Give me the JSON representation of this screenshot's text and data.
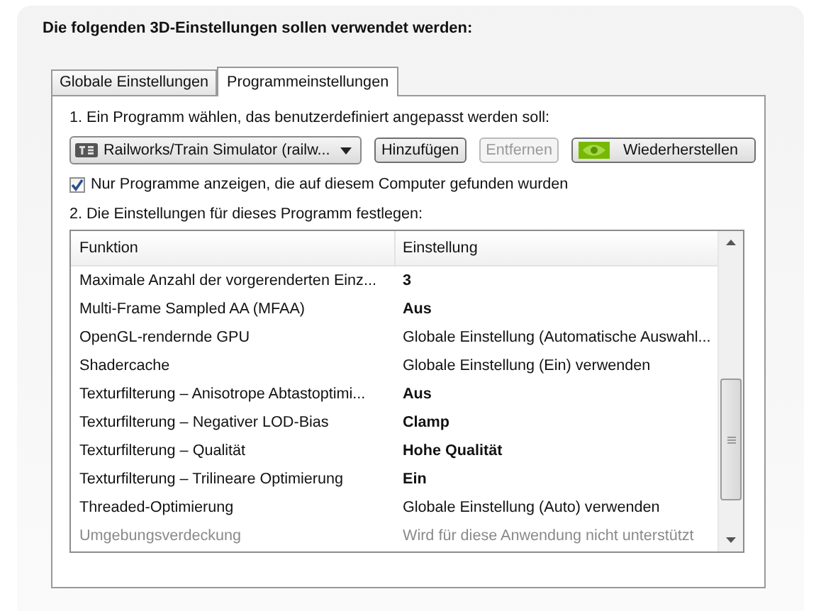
{
  "heading": "Die folgenden 3D-Einstellungen sollen verwendet werden:",
  "tabs": [
    {
      "label": "Globale Einstellungen",
      "selected": false
    },
    {
      "label": "Programmeinstellungen",
      "selected": true
    }
  ],
  "step1_label": "1. Ein Programm wählen, das benutzerdefiniert angepasst werden soll:",
  "program_select": {
    "value": "Railworks/Train Simulator (railw..."
  },
  "buttons": [
    {
      "label": "Hinzufügen",
      "disabled": false,
      "kind": "plain"
    },
    {
      "label": "Entfernen",
      "disabled": true,
      "kind": "plain"
    },
    {
      "label": "Wiederherstellen",
      "disabled": false,
      "kind": "logo"
    }
  ],
  "filter_checkbox": {
    "label": "Nur Programme anzeigen, die auf diesem Computer gefunden wurden",
    "checked": true
  },
  "step2_label": "2. Die Einstellungen für dieses Programm festlegen:",
  "table": {
    "columns": [
      "Funktion",
      "Einstellung"
    ],
    "rows": [
      {
        "function": "Maximale Anzahl der vorgerenderten Einz...",
        "setting": "3",
        "overridden": true,
        "disabled": false
      },
      {
        "function": "Multi-Frame Sampled AA (MFAA)",
        "setting": "Aus",
        "overridden": true,
        "disabled": false
      },
      {
        "function": "OpenGL-rendernde GPU",
        "setting": "Globale Einstellung (Automatische Auswahl...",
        "overridden": false,
        "disabled": false
      },
      {
        "function": "Shadercache",
        "setting": "Globale Einstellung (Ein) verwenden",
        "overridden": false,
        "disabled": false
      },
      {
        "function": "Texturfilterung – Anisotrope Abtastoptimi...",
        "setting": "Aus",
        "overridden": true,
        "disabled": false
      },
      {
        "function": "Texturfilterung – Negativer LOD-Bias",
        "setting": "Clamp",
        "overridden": true,
        "disabled": false
      },
      {
        "function": "Texturfilterung – Qualität",
        "setting": "Hohe Qualität",
        "overridden": true,
        "disabled": false
      },
      {
        "function": "Texturfilterung – Trilineare Optimierung",
        "setting": "Ein",
        "overridden": true,
        "disabled": false
      },
      {
        "function": "Threaded-Optimierung",
        "setting": "Globale Einstellung (Auto) verwenden",
        "overridden": false,
        "disabled": false
      },
      {
        "function": "Umgebungsverdeckung",
        "setting": "Wird für diese Anwendung nicht unterstützt",
        "overridden": false,
        "disabled": true
      }
    ]
  }
}
